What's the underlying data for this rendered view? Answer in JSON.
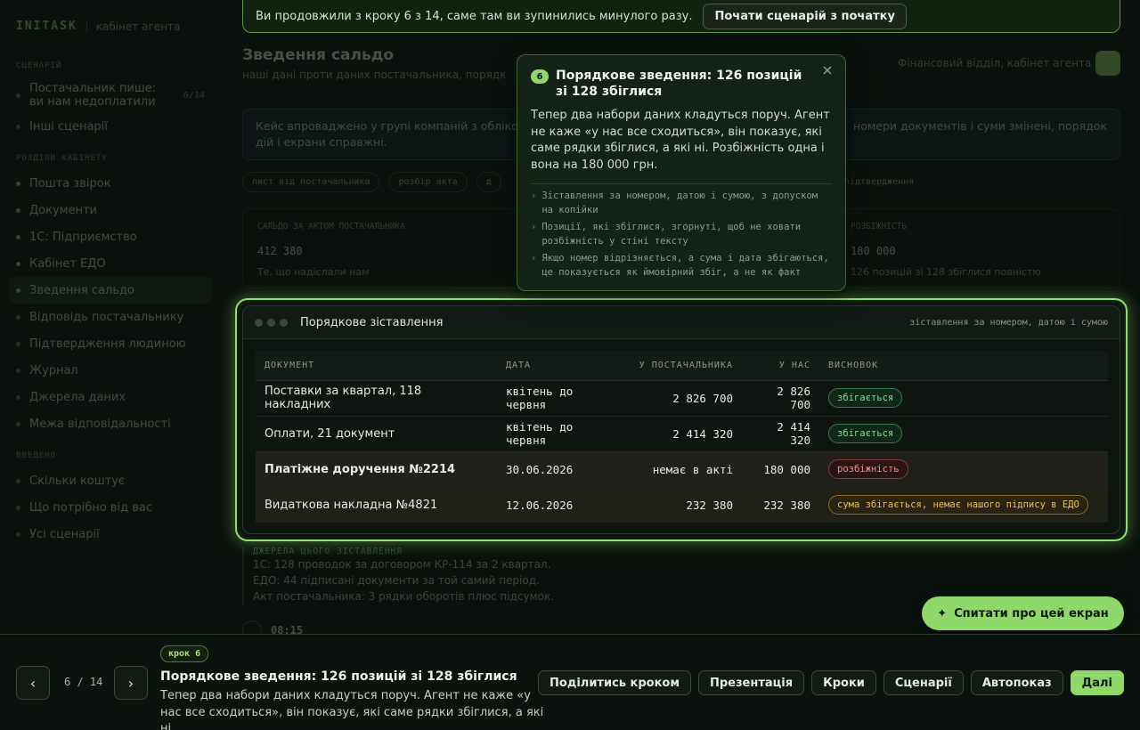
{
  "sidebar": {
    "brand": "INITASK",
    "brand_sub": "кабінет агента",
    "sections": [
      {
        "label": "СЦЕНАРІЙ"
      },
      {
        "label": "РОЗДІЛИ КАБІНЕТУ"
      },
      {
        "label": "ВВЕДЕНО"
      }
    ],
    "scenario_current": "Постачальник пише: ви нам недоплатили",
    "scenario_count": "6/14",
    "scenario_other": "Інші сценарії",
    "sections_items": [
      "Пошта звірок",
      "Документи",
      "1С: Підприємство",
      "Кабінет ЕДО",
      "Зведення сальдо",
      "Відповідь постачальнику",
      "Підтвердження людиною",
      "Журнал",
      "Джерела даних",
      "Межа відповідальності"
    ],
    "intro_items": [
      "Скільки коштує",
      "Що потрібно від вас",
      "Усі сценарії"
    ]
  },
  "page": {
    "title": "Зведення сальдо",
    "subtitle": "наші дані проти даних постачальника, порядк",
    "right_label": "Фінансовий відділ, кабінет агента",
    "note_line1_left": "Кейс впроваджено у групі компаній з обліков",
    "note_line1_right": "номери документів і суми змінені, порядок",
    "note_line2": "дій і екрани справжні.",
    "chips": [
      "лист від постачальника",
      "розбір акта",
      "д"
    ],
    "chip_right": "підтвердження",
    "stats": {
      "label_left": "САЛЬДО ЗА АКТОМ ПОСТАЧАЛЬНИКА",
      "value_left": "412 380",
      "sub_left": "Те, що надіслали нам",
      "label_right": "РОЗБІЖНІСТЬ",
      "value_right": "180 000",
      "sub_right": "126 позицій зі 128 збіглися повністю"
    },
    "sources": {
      "heading": "ДЖЕРЕЛА ЦЬОГО ЗІСТАВЛЕННЯ",
      "lines": [
        "1С: 128 проводок за договором КР-114 за 2 квартал.",
        "ЕДО: 44 підписані документи за той самий період.",
        "Акт постачальника: 3 рядки оборотів плюс підсумок."
      ]
    },
    "time": "08:15"
  },
  "banner": {
    "text": "Ви продовжили з кроку 6 з 14, саме там ви зупинились минулого разу.",
    "button": "Почати сценарій з початку"
  },
  "popover": {
    "badge": "6",
    "title": "Порядкове зведення: 126 позицій зі 128 збіглися",
    "body": "Тепер два набори даних кладуться поруч. Агент не каже «у нас все сходиться», він показує, які саме рядки збіглися, а які ні. Розбіжність одна і вона на 180 000 грн.",
    "bullets": [
      "Зіставлення за номером, датою і сумою, з допуском на копійки",
      "Позиції, які збіглися, згорнуті, щоб не ховати розбіжність у стіні тексту",
      "Якщо номер відрізняється, а сума і дата збігаються, це показується як ймовірний збіг, а не як факт"
    ],
    "close": "×"
  },
  "window": {
    "title": "Порядкове зіставлення",
    "meta": "зіставлення за номером, датою і сумою",
    "columns": [
      "ДОКУМЕНТ",
      "ДАТА",
      "У ПОСТАЧАЛЬНИКА",
      "У НАС",
      "ВИСНОВОК"
    ],
    "rows": [
      {
        "doc": "Поставки за квартал, 118 накладних",
        "date": "квітень до червня",
        "supplier": "2 826 700",
        "ours": "2 826 700",
        "verdict": "збігається"
      },
      {
        "doc": "Оплати, 21 документ",
        "date": "квітень до червня",
        "supplier": "2 414 320",
        "ours": "2 414 320",
        "verdict": "збігається"
      },
      {
        "doc": "Платіжне доручення №2214",
        "date": "30.06.2026",
        "supplier": "немає в акті",
        "ours": "180 000",
        "verdict": "розбіжність"
      },
      {
        "doc": "Видаткова накладна №4821",
        "date": "12.06.2026",
        "supplier": "232 380",
        "ours": "232 380",
        "verdict": "сума збігається, немає нашого підпису в ЕДО"
      }
    ]
  },
  "ask_button": "Спитати про цей екран",
  "tour": {
    "counter": "6 / 14",
    "step_chip": "крок 6",
    "title": "Порядкове зведення: 126 позицій зі 128 збіглися",
    "desc": "Тепер два набори даних кладуться поруч. Агент не каже «у нас все сходиться», він показує, які саме рядки збіглися, а які ні....",
    "actions": [
      "Поділитись кроком",
      "Презентація",
      "Кроки",
      "Сценарії",
      "Автопоказ",
      "Далі"
    ]
  },
  "colors": {
    "accent": "#8fd86a",
    "ok": "#7fe08a",
    "bad": "#f08a8a",
    "warn": "#e7c25a"
  }
}
